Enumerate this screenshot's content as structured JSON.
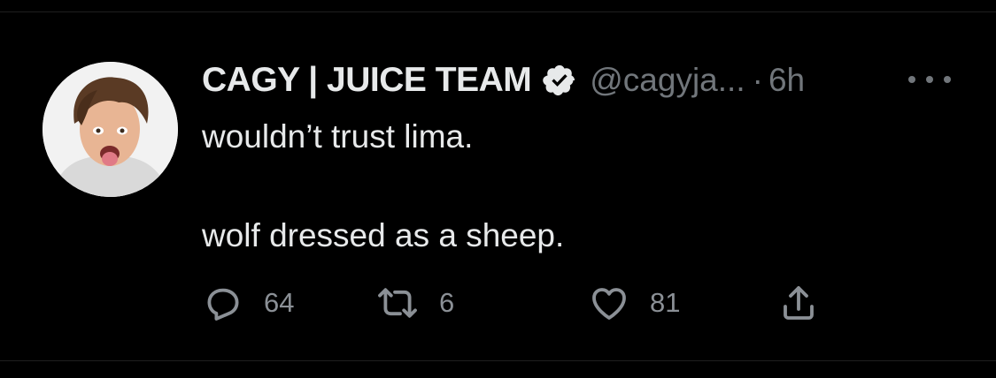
{
  "tweet": {
    "author": {
      "display_name": "CAGY | JUICE TEAM",
      "handle": "@cagyja...",
      "verified": true,
      "avatar_icon": "profile-photo"
    },
    "separator": "·",
    "time": "6h",
    "text_lines": [
      "wouldn’t trust lima.",
      "wolf dressed as a sheep."
    ],
    "stats": {
      "replies": "64",
      "retweets": "6",
      "likes": "81"
    }
  },
  "colors": {
    "background": "#000000",
    "primary_text": "#e7e9ea",
    "secondary_text": "#71767b",
    "divider": "#1f1f1f"
  },
  "icons": {
    "more": "more-icon",
    "reply": "reply-icon",
    "retweet": "retweet-icon",
    "like": "heart-icon",
    "share": "share-icon",
    "verified": "verified-badge-icon"
  }
}
